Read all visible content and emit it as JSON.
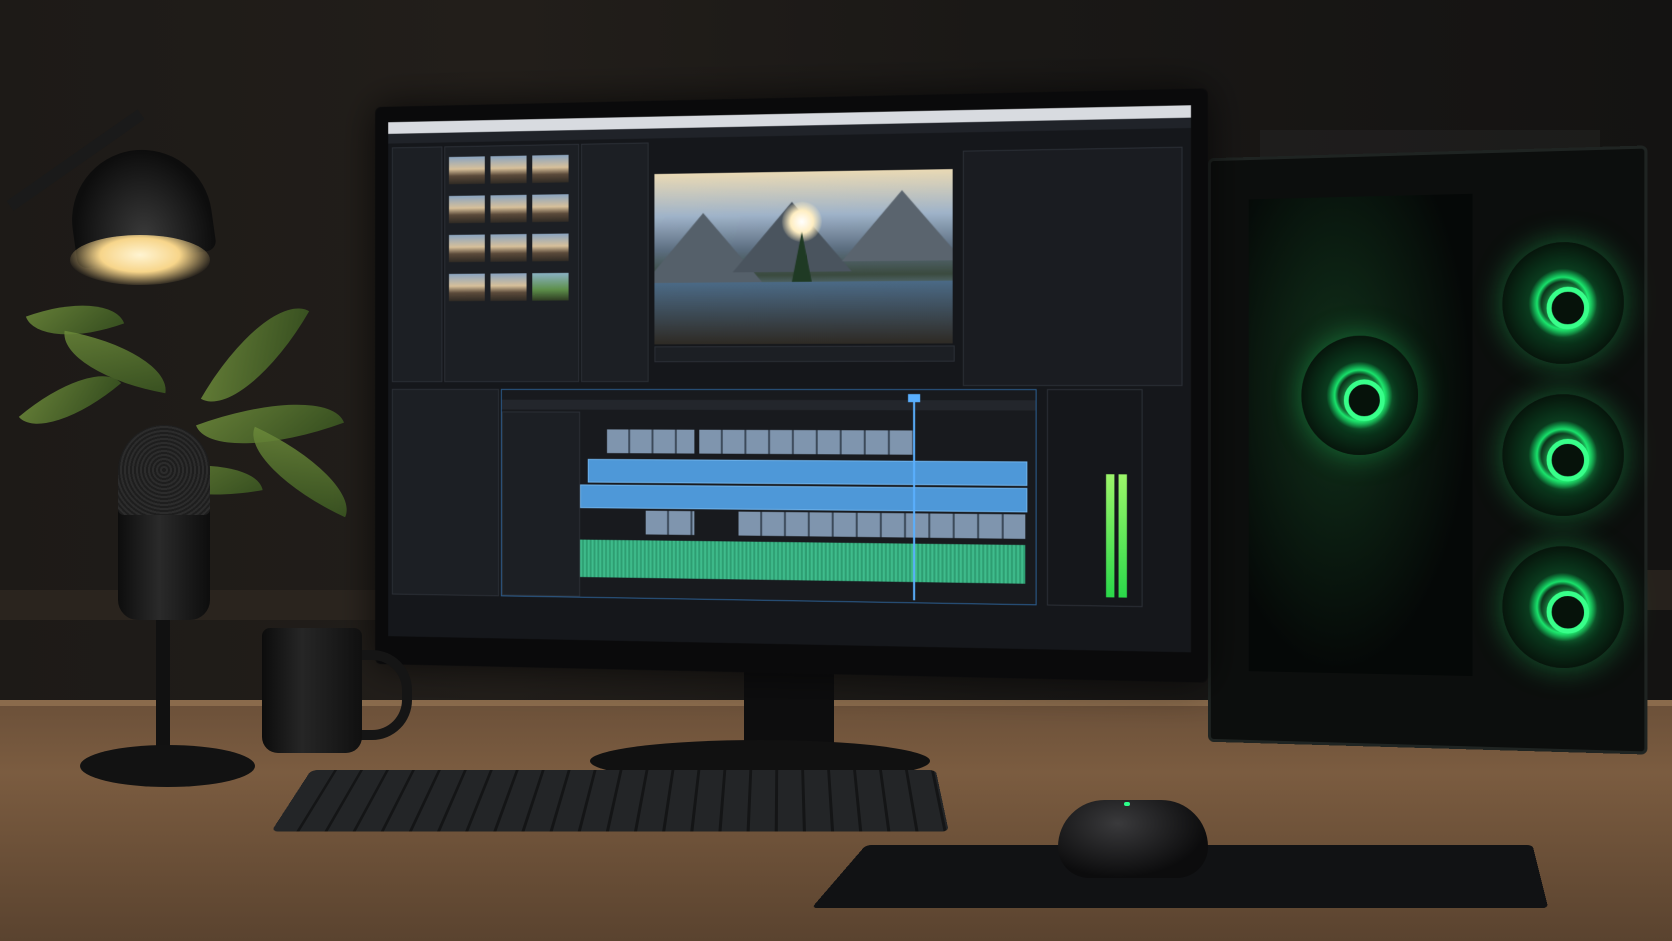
{
  "scene": {
    "description_label": "",
    "accent_colors": {
      "pc_fan_glow": "#2cff7a",
      "timeline_clip": "#4e98d8",
      "audio_wave": "#3fbc8c",
      "lamp_light": "#f7d58a"
    }
  },
  "monitor": {
    "app": {
      "titlebar": "",
      "program_monitor": {
        "image": "mountain-lake-landscape"
      },
      "timeline": {
        "video_tracks": 3,
        "audio_tracks": 1
      }
    }
  },
  "icons": [
    "desk-lamp-icon",
    "microphone-icon",
    "mug-icon",
    "keyboard-icon",
    "mouse-icon",
    "pc-fan-icon"
  ]
}
